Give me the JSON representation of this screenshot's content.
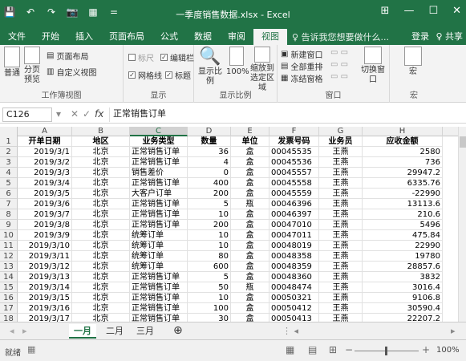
{
  "window": {
    "qat": [
      "💾",
      "↶",
      "↷",
      "📷",
      "▦",
      "="
    ],
    "title": "一季度销售数据.xlsx - Excel",
    "controls": [
      "⊞",
      "—",
      "☐",
      "✕"
    ]
  },
  "tabs": [
    "文件",
    "开始",
    "插入",
    "页面布局",
    "公式",
    "数据",
    "审阅",
    "视图"
  ],
  "active_tab": "视图",
  "tellme": "♀ 告诉我您想要做什么...",
  "signin": "登录",
  "share": "♀ 共享",
  "ribbon": {
    "views": {
      "normal": "普通",
      "pagebreak": "分页预览",
      "pagelayout": "页面布局",
      "custom": "自定义视图",
      "label": "工作簿视图"
    },
    "show": {
      "ruler": "标尺",
      "formulabar": "编辑栏",
      "gridlines": "网格线",
      "headings": "标题",
      "label": "显示"
    },
    "zoom": {
      "zoom": "显示比例",
      "hundred": "100%",
      "zoomsel": "缩放到选定区域",
      "label": "显示比例"
    },
    "window": {
      "newwin": "新建窗口",
      "arrange": "全部重排",
      "freeze": "冻结窗格",
      "switch": "切换窗口",
      "label": "窗口"
    },
    "macro": {
      "macro": "宏",
      "label": "宏"
    }
  },
  "formula_bar": {
    "namebox": "C126",
    "fx": "fx",
    "content": "正常销售订单"
  },
  "columns": [
    "A",
    "B",
    "C",
    "D",
    "E",
    "F",
    "G",
    "H"
  ],
  "selected_column": "C",
  "header": [
    "开单日期",
    "地区",
    "业务类型",
    "数量",
    "单位",
    "发票号码",
    "业务员",
    "应收金额"
  ],
  "rows": [
    [
      "2019/3/1",
      "北京",
      "正常销售订单",
      "36",
      "盒",
      "00045535",
      "王燕",
      "2580"
    ],
    [
      "2019/3/2",
      "北京",
      "正常销售订单",
      "4",
      "盒",
      "00045536",
      "王燕",
      "736"
    ],
    [
      "2019/3/3",
      "北京",
      "销售差价",
      "0",
      "盒",
      "00045557",
      "王燕",
      "29947.2"
    ],
    [
      "2019/3/4",
      "北京",
      "正常销售订单",
      "400",
      "盒",
      "00045558",
      "王燕",
      "6335.76"
    ],
    [
      "2019/3/5",
      "北京",
      "大客户订单",
      "200",
      "盒",
      "00045559",
      "王燕",
      "-22990"
    ],
    [
      "2019/3/6",
      "北京",
      "正常销售订单",
      "5",
      "瓶",
      "00046396",
      "王燕",
      "13113.6"
    ],
    [
      "2019/3/7",
      "北京",
      "正常销售订单",
      "10",
      "盒",
      "00046397",
      "王燕",
      "210.6"
    ],
    [
      "2019/3/8",
      "北京",
      "正常销售订单",
      "200",
      "盒",
      "00047010",
      "王燕",
      "5496"
    ],
    [
      "2019/3/9",
      "北京",
      "统筹订单",
      "10",
      "盒",
      "00047011",
      "王燕",
      "475.84"
    ],
    [
      "2019/3/10",
      "北京",
      "统筹订单",
      "10",
      "盒",
      "00048019",
      "王燕",
      "22990"
    ],
    [
      "2019/3/11",
      "北京",
      "统筹订单",
      "80",
      "盒",
      "00048358",
      "王燕",
      "19780"
    ],
    [
      "2019/3/12",
      "北京",
      "统筹订单",
      "600",
      "盒",
      "00048359",
      "王燕",
      "28857.6"
    ],
    [
      "2019/3/13",
      "北京",
      "正常销售订单",
      "5",
      "盒",
      "00048360",
      "王燕",
      "3832"
    ],
    [
      "2019/3/14",
      "北京",
      "正常销售订单",
      "50",
      "瓶",
      "00048474",
      "王燕",
      "3016.4"
    ],
    [
      "2019/3/15",
      "北京",
      "正常销售订单",
      "10",
      "盒",
      "00050321",
      "王燕",
      "9106.8"
    ],
    [
      "2019/3/16",
      "北京",
      "正常销售订单",
      "100",
      "盒",
      "00050412",
      "王燕",
      "30590.4"
    ],
    [
      "2019/3/17",
      "北京",
      "正常销售订单",
      "30",
      "盒",
      "00050413",
      "王燕",
      "22207.2"
    ]
  ],
  "sheets": [
    "一月",
    "二月",
    "三月"
  ],
  "active_sheet": "一月",
  "status": {
    "ready": "就绪",
    "zoom": "100%"
  }
}
